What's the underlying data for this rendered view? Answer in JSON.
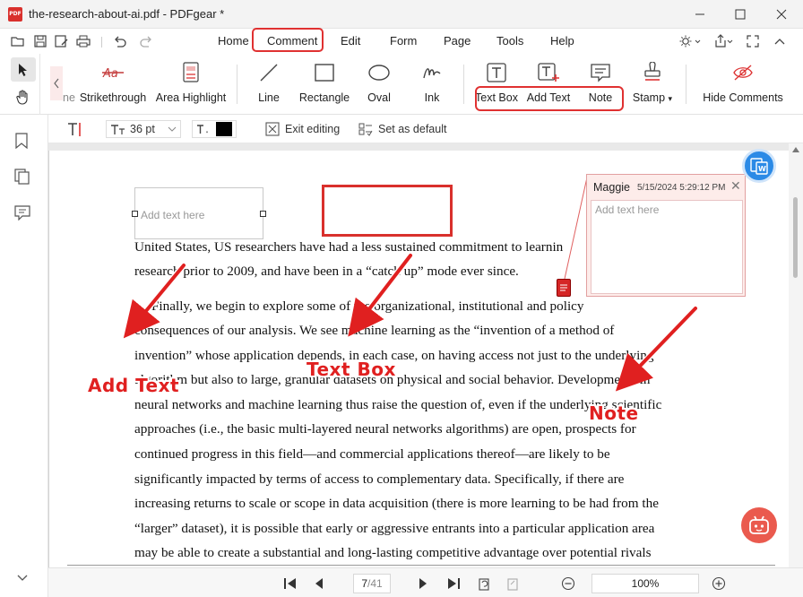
{
  "window": {
    "title": "the-research-about-ai.pdf - PDFgear *",
    "app_icon_text": "PDF"
  },
  "menu": {
    "items": [
      "Home",
      "Comment",
      "Edit",
      "Form",
      "Page",
      "Tools",
      "Help"
    ],
    "active": "Comment"
  },
  "ribbon": {
    "partial_label": "ne",
    "tools": {
      "strikethrough": "Strikethrough",
      "area_highlight": "Area Highlight",
      "line": "Line",
      "rectangle": "Rectangle",
      "oval": "Oval",
      "ink": "Ink",
      "text_box": "Text Box",
      "add_text": "Add Text",
      "note": "Note",
      "stamp": "Stamp",
      "hide_comments": "Hide Comments"
    }
  },
  "properties": {
    "font_size": "36 pt",
    "text_color": "#000000",
    "exit_editing": "Exit editing",
    "set_default": "Set as default"
  },
  "document": {
    "lines": [
      "United States, US researchers have had a less sustained commitment to learnin",
      "research prior to 2009, and have been in a “catch up” mode ever since.",
      "     Finally, we begin to explore some of the organizational, institutional and policy",
      "consequences of our analysis.  We see machine learning as the “invention of a method of",
      "invention” whose application depends, in each case, on having access not just to the underlying",
      "algorithm but also to large, granular datasets on physical and social behavior.  Developments in",
      "neural networks and machine learning thus raise the question of, even if the underlying scientific",
      "approaches (i.e., the basic multi-layered neural networks algorithms) are open, prospects for",
      "continued progress in this field—and commercial applications thereof—are likely to be",
      "significantly impacted by terms of access to complementary data.  Specifically, if there are",
      "increasing returns to scale or scope in data acquisition (there is more learning to be had from the",
      "“larger” dataset), it is possible that early or aggressive entrants into a particular application area",
      "may be able to create a substantial and long-lasting competitive advantage over potential rivals"
    ],
    "add_text_placeholder": "Add text here"
  },
  "note_popup": {
    "author": "Maggie",
    "time": "5/15/2024 5:29:12 PM",
    "placeholder": "Add text here"
  },
  "callouts": {
    "add_text": "Add Text",
    "text_box": "Text Box",
    "note": "Note"
  },
  "navigation": {
    "page_current": "7",
    "page_total": "/41",
    "zoom": "100%"
  },
  "colors": {
    "accent_red": "#e03131",
    "note_marker": "#d52626",
    "fab_blue": "#2b8ae6",
    "fab_red": "#ea5a4e"
  }
}
